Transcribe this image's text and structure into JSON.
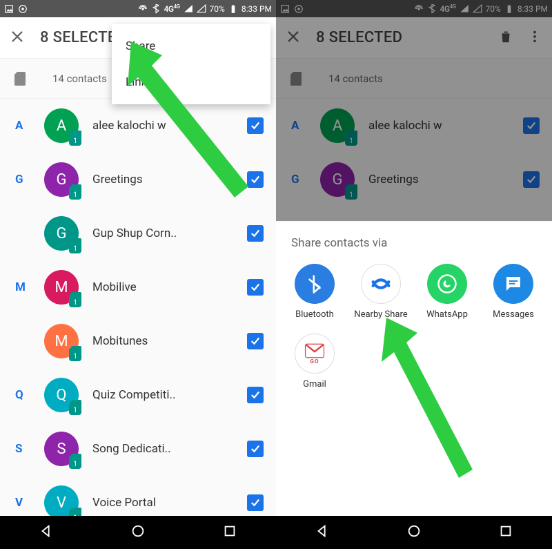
{
  "status": {
    "time": "8:33 PM",
    "battery": "70%",
    "net": "4G",
    "net_sup": "4G"
  },
  "toolbar": {
    "title": "8 SELECTED"
  },
  "subhead": {
    "text": "14 contacts"
  },
  "letters": {
    "A": "A",
    "G": "G",
    "M": "M",
    "Q": "Q",
    "S": "S",
    "V": "V"
  },
  "contacts": {
    "a": {
      "initial": "A",
      "name": "alee kalochi w",
      "sim": "1"
    },
    "g1": {
      "initial": "G",
      "name": "Greetings",
      "sim": "1"
    },
    "g2": {
      "initial": "G",
      "name": "Gup Shup Corn..",
      "sim": "1"
    },
    "m1": {
      "initial": "M",
      "name": "Mobilive",
      "sim": "1"
    },
    "m2": {
      "initial": "M",
      "name": "Mobitunes",
      "sim": "1"
    },
    "q": {
      "initial": "Q",
      "name": "Quiz Competiti..",
      "sim": "1"
    },
    "s": {
      "initial": "S",
      "name": "Song Dedicati..",
      "sim": "1"
    },
    "v": {
      "initial": "V",
      "name": "Voice Portal",
      "sim": "1"
    }
  },
  "menu": {
    "share": "Share",
    "link": "Link"
  },
  "share": {
    "title": "Share contacts via",
    "items": {
      "bluetooth": "Bluetooth",
      "nearby": "Nearby Share",
      "whatsapp": "WhatsApp",
      "messages": "Messages",
      "gmail": "Gmail"
    },
    "gmail_sub": "GO"
  }
}
